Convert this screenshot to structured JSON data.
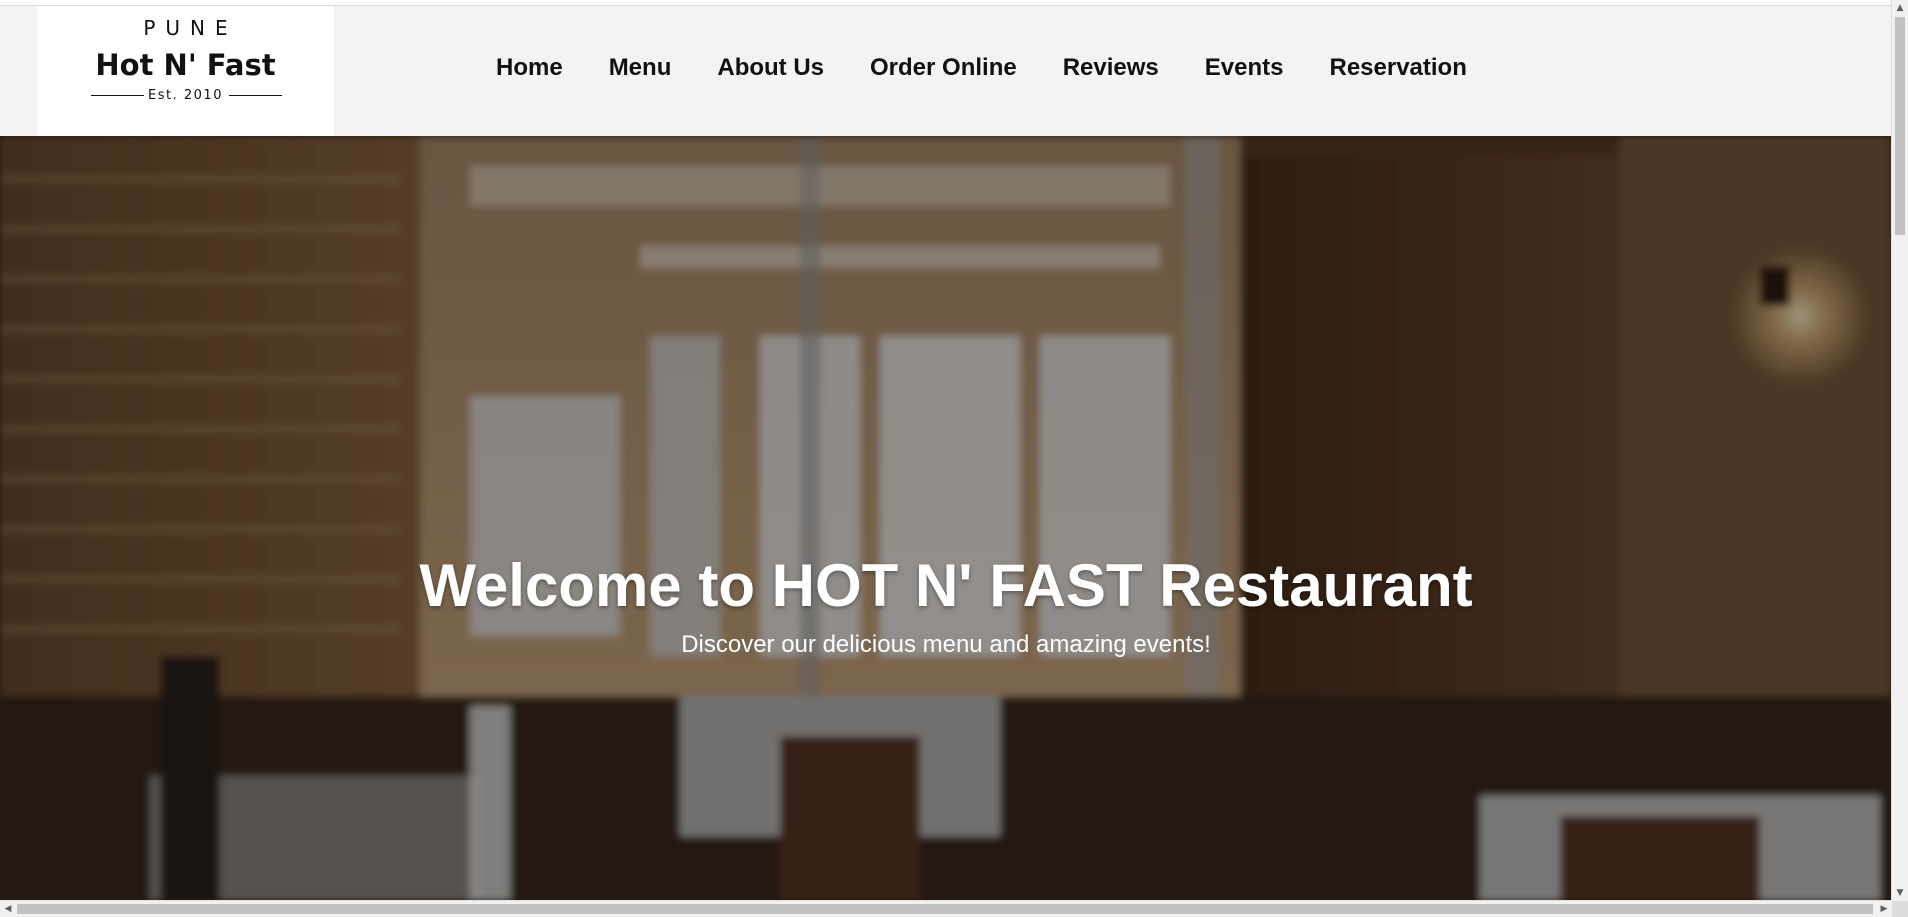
{
  "logo": {
    "city": "PUNE",
    "name": "Hot N' Fast",
    "established": "Est. 2010"
  },
  "nav": {
    "items": [
      {
        "label": "Home"
      },
      {
        "label": "Menu"
      },
      {
        "label": "About Us"
      },
      {
        "label": "Order Online"
      },
      {
        "label": "Reviews"
      },
      {
        "label": "Events"
      },
      {
        "label": "Reservation"
      }
    ]
  },
  "hero": {
    "title": "Welcome to HOT N' FAST Restaurant",
    "subtitle": "Discover our delicious menu and amazing events!",
    "background_description_icon": "restaurant-interior-image"
  },
  "scrollbars": {
    "up_arrow": "▲",
    "down_arrow": "▼",
    "left_arrow": "◀",
    "right_arrow": "▶"
  },
  "colors": {
    "header_bg": "#f3f3f3",
    "nav_text": "#111111",
    "hero_text": "#ffffff"
  }
}
